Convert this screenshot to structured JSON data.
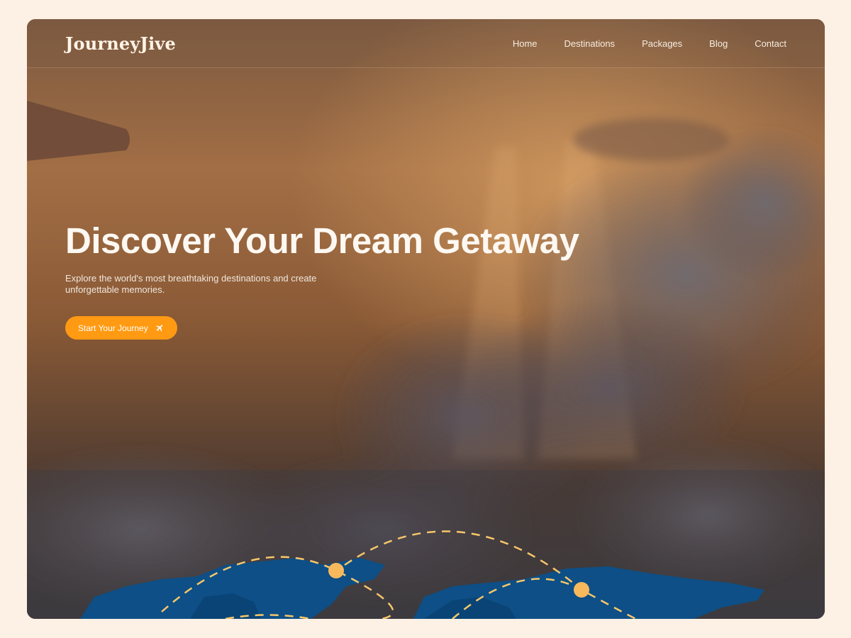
{
  "brand": {
    "name": "JourneyJive"
  },
  "nav": {
    "items": [
      {
        "label": "Home"
      },
      {
        "label": "Destinations"
      },
      {
        "label": "Packages"
      },
      {
        "label": "Blog"
      },
      {
        "label": "Contact"
      }
    ]
  },
  "hero": {
    "title": "Discover Your Dream Getaway",
    "subtitle": "Explore the world's most breathtaking destinations and create unforgettable memories.",
    "cta_label": "Start Your Journey",
    "cta_icon": "airplane-icon"
  },
  "colors": {
    "page_background": "#fdf0e4",
    "accent": "#ff9a12",
    "map_land": "#0d4f86",
    "route_line": "#f7c66a",
    "marker": "#f8b95d"
  }
}
